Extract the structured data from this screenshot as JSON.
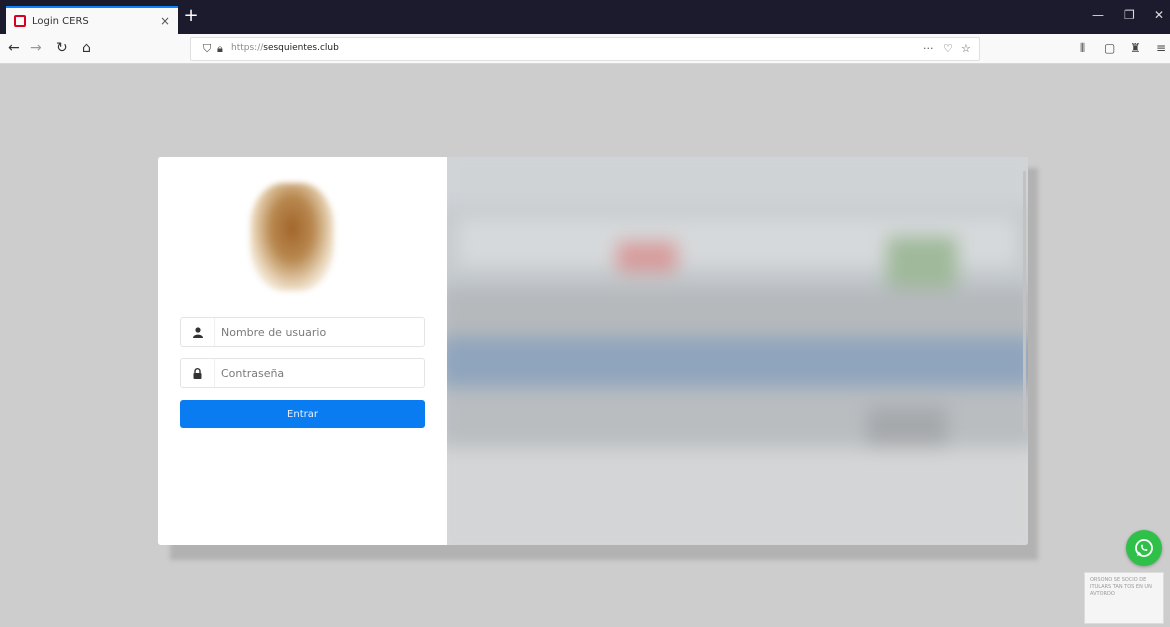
{
  "browser": {
    "tab_title": "Login CERS",
    "tab_close": "×",
    "new_tab": "+",
    "window_controls": [
      "—",
      "❐",
      "✕"
    ],
    "nav": {
      "back": "←",
      "forward": "→",
      "reload": "↻",
      "home": "⌂"
    },
    "url_prefix": "https://",
    "url_domain": "sesquientes.club",
    "url_actions": [
      "···",
      "♡",
      "☆"
    ],
    "toolbar_icons": [
      "⫴",
      "▢",
      "♜",
      "≡"
    ]
  },
  "login": {
    "username_placeholder": "Nombre de usuario",
    "password_placeholder": "Contraseña",
    "submit_label": "Entrar",
    "user_icon": "user-icon",
    "lock_icon": "lock-icon"
  },
  "widgets": {
    "whatsapp_icon": "whatsapp-icon",
    "whatsapp_color": "#2fc04a",
    "badge_text": "ORSONO SE SOCIO DE ITULARS TAN TOS EN UN AVTORDO"
  },
  "colors": {
    "accent": "#0a7cf2",
    "tab_indicator": "#0a84ff",
    "page_bg": "#cdcdcd"
  }
}
